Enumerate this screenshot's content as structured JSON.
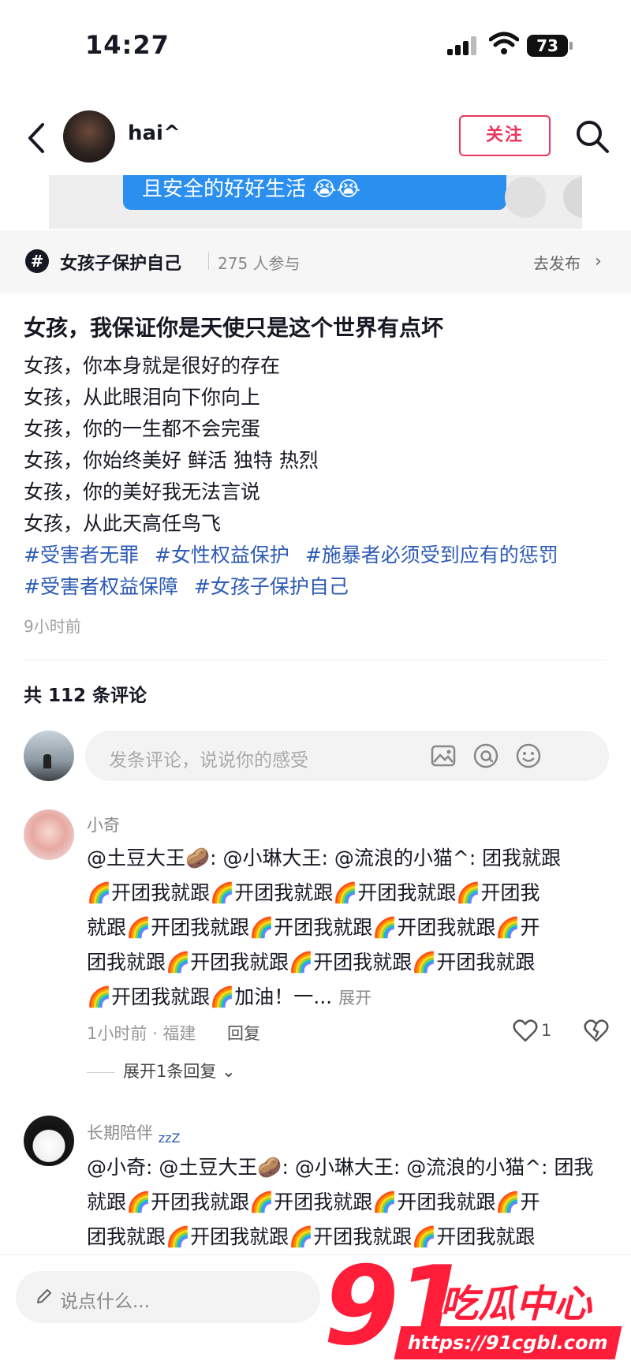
{
  "status_bar": {
    "time": "14:27",
    "battery": "73"
  },
  "header": {
    "username": "hai^",
    "follow_label": "关注"
  },
  "video": {
    "caption": "且安全的好好生活 😭😭"
  },
  "topic": {
    "name": "女孩子保护自己",
    "count": "275 人参与",
    "action": "去发布"
  },
  "post": {
    "title": "女孩，我保证你是天使只是这个世界有点坏",
    "lines": [
      "女孩，你本身就是很好的存在",
      "女孩，从此眼泪向下你向上",
      "女孩，你的一生都不会完蛋",
      "女孩，你始终美好 鲜活 独特 热烈",
      "女孩，你的美好我无法言说",
      "女孩，从此天高任鸟飞"
    ],
    "hashtags_row1": [
      "#受害者无罪",
      "#女性权益保护",
      "#施暴者必须受到应有的惩罚"
    ],
    "hashtags_row2": [
      "#受害者权益保障",
      "#女孩子保护自己"
    ],
    "time": "9小时前"
  },
  "comments_section": {
    "count_label": "共 112 条评论",
    "composer_placeholder": "发条评论，说说你的感受"
  },
  "comments": [
    {
      "name": "小奇",
      "lines": [
        "@土豆大王🥔: @小琳大王: @流浪的小猫^: 团我就跟",
        "🌈开团我就跟🌈开团我就跟🌈开团我就跟🌈开团我",
        "就跟🌈开团我就跟🌈开团我就跟🌈开团我就跟🌈开",
        "团我就跟🌈开团我就跟🌈开团我就跟🌈开团我就跟",
        "🌈开团我就跟🌈加油！一..."
      ],
      "expand": "展开",
      "meta": "1小时前 · 福建",
      "reply": "回复",
      "likes": "1",
      "replies": "展开1条回复 ⌄"
    },
    {
      "name": "长期陪伴",
      "name_suffix": "zzZ",
      "lines": [
        "@小奇: @土豆大王🥔: @小琳大王: @流浪的小猫^: 团我",
        "就跟🌈开团我就跟🌈开团我就跟🌈开团我就跟🌈开",
        "团我就跟🌈开团我就跟🌈开团我就跟🌈开团我就跟"
      ]
    }
  ],
  "bottom_bar": {
    "placeholder": "说点什么..."
  },
  "watermark": {
    "big": "91",
    "text": "吃瓜中心",
    "url": "https://91cgbl.com"
  },
  "colors": {
    "accent_red": "#e8365d",
    "hashtag_blue": "#2d5bb5",
    "bubble_blue": "#2b8ff0"
  }
}
